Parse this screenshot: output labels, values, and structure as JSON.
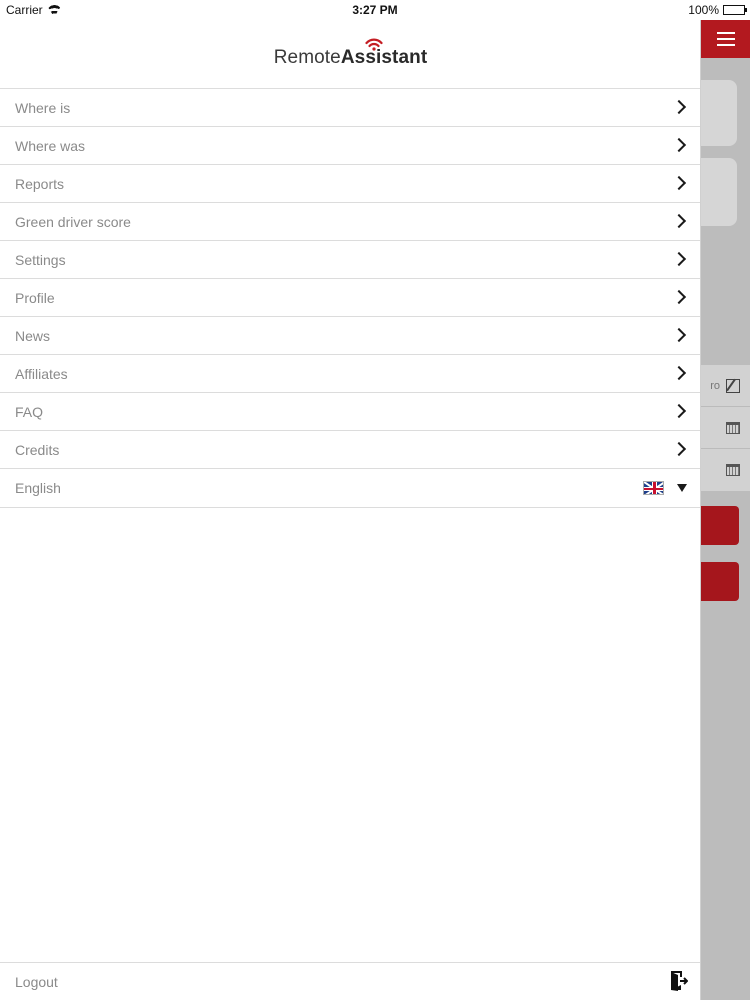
{
  "status_bar": {
    "carrier": "Carrier",
    "time": "3:27 PM",
    "battery": "100%"
  },
  "app": {
    "logo_light": "Remote",
    "logo_bold": "Assistant",
    "brand_color": "#b3191f"
  },
  "menu": {
    "items": [
      {
        "label": "Where is"
      },
      {
        "label": "Where was"
      },
      {
        "label": "Reports"
      },
      {
        "label": "Green driver score"
      },
      {
        "label": "Settings"
      },
      {
        "label": "Profile"
      },
      {
        "label": "News"
      },
      {
        "label": "Affiliates"
      },
      {
        "label": "FAQ"
      },
      {
        "label": "Credits"
      }
    ],
    "language": {
      "selected": "English",
      "flag": "uk-flag-icon"
    },
    "logout": "Logout"
  },
  "background_form": {
    "field_snippet": "ro"
  }
}
